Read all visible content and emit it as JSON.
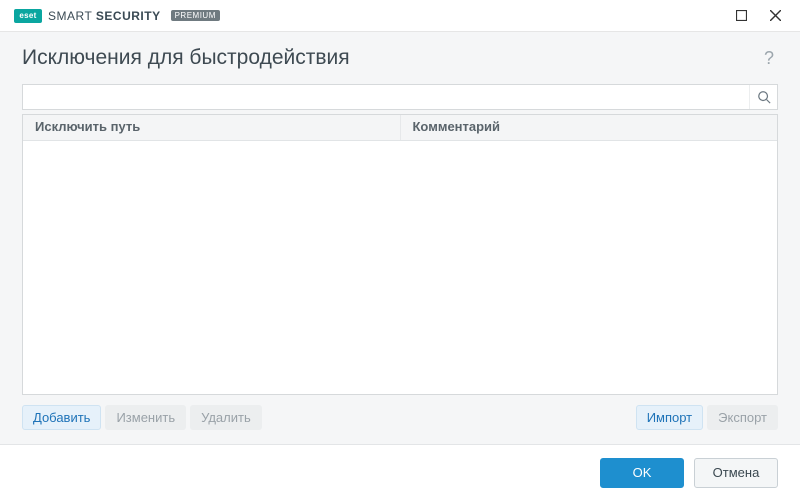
{
  "titlebar": {
    "logo_text": "eset",
    "brand_thin": "SMART ",
    "brand_bold": "SECURITY",
    "premium": "PREMIUM"
  },
  "header": {
    "title": "Исключения для быстродействия",
    "help": "?"
  },
  "search": {
    "value": "",
    "placeholder": ""
  },
  "table": {
    "col_path": "Исключить путь",
    "col_comment": "Комментарий"
  },
  "toolbar": {
    "add": "Добавить",
    "edit": "Изменить",
    "delete": "Удалить",
    "import": "Импорт",
    "export": "Экспорт"
  },
  "footer": {
    "ok": "OK",
    "cancel": "Отмена"
  }
}
